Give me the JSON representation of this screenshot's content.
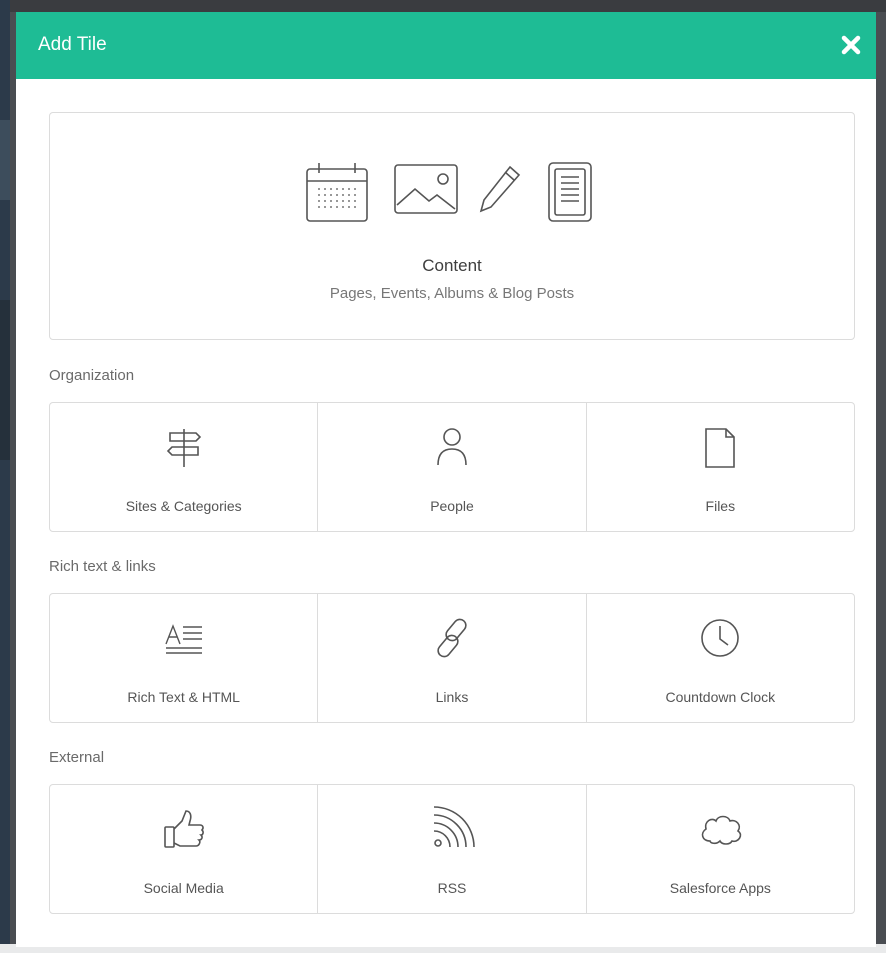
{
  "modal": {
    "title": "Add Tile",
    "close_icon": "close-icon",
    "accent_color": "#1ebc95"
  },
  "content_tile": {
    "title": "Content",
    "subtitle": "Pages, Events, Albums & Blog Posts",
    "icons": [
      "calendar-icon",
      "image-icon",
      "pencil-icon",
      "document-icon"
    ]
  },
  "sections": [
    {
      "label": "Organization",
      "tiles": [
        {
          "label": "Sites & Categories",
          "icon": "signpost-icon"
        },
        {
          "label": "People",
          "icon": "person-icon"
        },
        {
          "label": "Files",
          "icon": "file-icon"
        }
      ]
    },
    {
      "label": "Rich text & links",
      "tiles": [
        {
          "label": "Rich Text & HTML",
          "icon": "rich-text-icon"
        },
        {
          "label": "Links",
          "icon": "link-icon"
        },
        {
          "label": "Countdown Clock",
          "icon": "clock-icon"
        }
      ]
    },
    {
      "label": "External",
      "tiles": [
        {
          "label": "Social Media",
          "icon": "thumbs-up-icon"
        },
        {
          "label": "RSS",
          "icon": "rss-icon"
        },
        {
          "label": "Salesforce Apps",
          "icon": "cloud-icon"
        }
      ]
    }
  ]
}
